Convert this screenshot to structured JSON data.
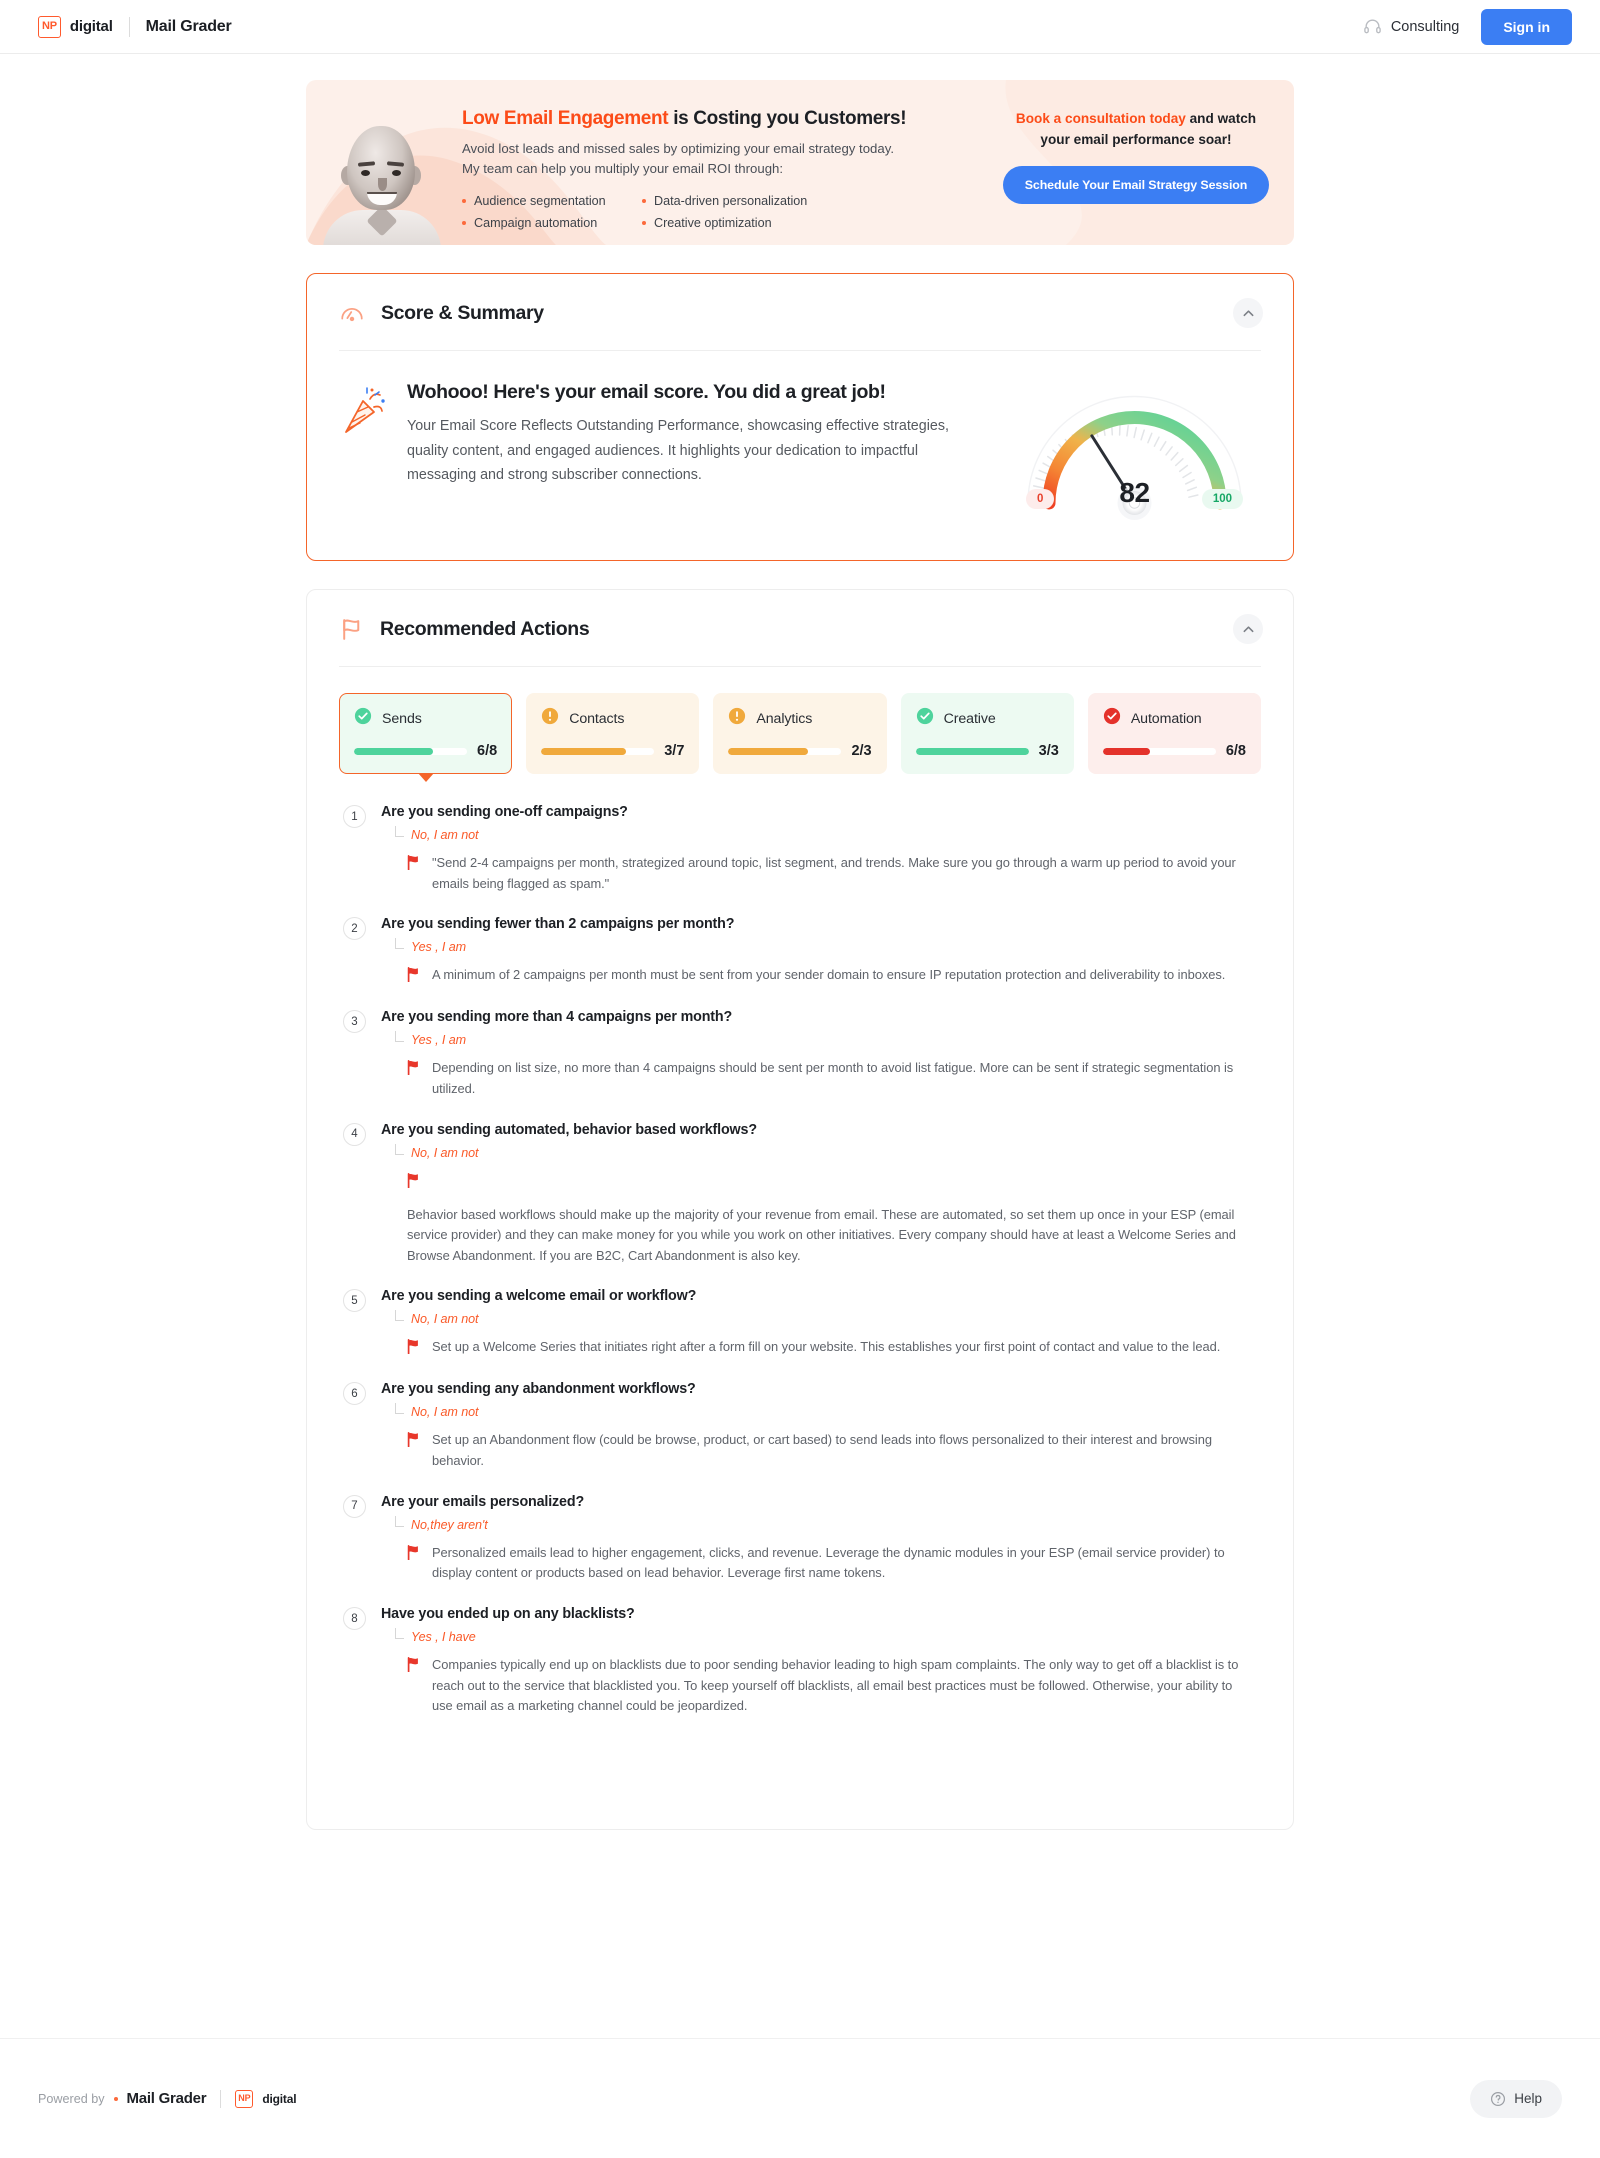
{
  "header": {
    "logo_np": "NP",
    "logo_word": "digital",
    "app_title": "Mail Grader",
    "consulting_label": "Consulting",
    "signin_label": "Sign in"
  },
  "promo": {
    "headline_highlight": "Low Email Engagement",
    "headline_rest": " is Costing you Customers!",
    "sub_line_1": "Avoid lost leads and missed sales by optimizing your email strategy today.",
    "sub_line_2": "My team can help you multiply your email ROI through:",
    "bullets": [
      "Audience segmentation",
      "Data-driven personalization",
      "Campaign automation",
      "Creative optimization"
    ],
    "cta_highlight": "Book a consultation today",
    "cta_rest": " and watch",
    "cta_line2": "your email performance soar!",
    "cta_button": "Schedule Your Email Strategy Session"
  },
  "score_card": {
    "title": "Score & Summary",
    "heading": "Wohooo! Here's your email score. You did a great job!",
    "description": "Your Email Score Reflects Outstanding Performance, showcasing effective strategies, quality content, and engaged audiences. It highlights your dedication to impactful messaging and strong subscriber connections.",
    "gauge": {
      "value": "82",
      "min_label": "0",
      "max_label": "100",
      "min": 0,
      "max": 100,
      "needle_color": "#2b2f36",
      "track_start_color": "#ef4123",
      "track_end_color": "#4ed39c"
    }
  },
  "actions_card": {
    "title": "Recommended Actions",
    "tabs": [
      {
        "label": "Sends",
        "ratio": "6/8",
        "value": 6,
        "total": 8,
        "status": "ok",
        "fill_pct": 70,
        "accent": "#4ed39c",
        "bg": "#edfaf2",
        "active": true
      },
      {
        "label": "Contacts",
        "ratio": "3/7",
        "value": 3,
        "total": 7,
        "status": "warn",
        "fill_pct": 75,
        "accent": "#f0a93c",
        "bg": "#fdf4e7",
        "active": false
      },
      {
        "label": "Analytics",
        "ratio": "2/3",
        "value": 2,
        "total": 3,
        "status": "warn",
        "fill_pct": 70,
        "accent": "#f0a93c",
        "bg": "#fdf4e7",
        "active": false
      },
      {
        "label": "Creative",
        "ratio": "3/3",
        "value": 3,
        "total": 3,
        "status": "ok",
        "fill_pct": 100,
        "accent": "#4ed39c",
        "bg": "#edfaf2",
        "active": false
      },
      {
        "label": "Automation",
        "ratio": "6/8",
        "value": 6,
        "total": 8,
        "status": "error",
        "fill_pct": 42,
        "accent": "#e4322b",
        "bg": "#fdeeec",
        "active": false
      }
    ],
    "questions": [
      {
        "num": "1",
        "question": "Are you sending one-off campaigns?",
        "answer": "No, I am not",
        "advice": "\"Send 2-4 campaigns per month, strategized around topic, list segment, and trends. Make sure you go through a warm up period to avoid your emails being flagged as spam.\"",
        "stacked": false
      },
      {
        "num": "2",
        "question": "Are you sending fewer than 2 campaigns per month?",
        "answer": "Yes , I am",
        "advice": "A minimum of 2 campaigns per month must be sent from your sender domain to ensure IP reputation protection and deliverability to inboxes.",
        "stacked": false
      },
      {
        "num": "3",
        "question": "Are you sending more than 4 campaigns per month?",
        "answer": "Yes , I am",
        "advice": "Depending on list size, no more than 4 campaigns should be sent per month to avoid list fatigue. More can be sent if strategic segmentation is utilized.",
        "stacked": false
      },
      {
        "num": "4",
        "question": "Are you sending automated, behavior based workflows?",
        "answer": "No, I am not",
        "advice": "Behavior based workflows should make up the majority of your revenue from email. These are automated, so set them up once in your ESP (email service provider) and they can make money for you while you work on other initiatives. Every company should have at least a Welcome Series and Browse Abandonment. If you are B2C, Cart Abandonment is also key.",
        "stacked": true
      },
      {
        "num": "5",
        "question": "Are you sending a welcome email or workflow?",
        "answer": "No, I am not",
        "advice": "Set up a Welcome Series that initiates right after a form fill on your website. This establishes your first point of contact and value to the lead.",
        "stacked": false
      },
      {
        "num": "6",
        "question": "Are you sending any abandonment workflows?",
        "answer": "No, I am not",
        "advice": "Set up an Abandonment flow (could be browse, product, or cart based) to send leads into flows personalized to their interest and browsing behavior.",
        "stacked": false
      },
      {
        "num": "7",
        "question": "Are your emails personalized?",
        "answer": "No,they aren't",
        "advice": "Personalized emails lead to higher engagement, clicks, and revenue. Leverage the dynamic modules in your ESP (email service provider) to display content or products based on lead behavior. Leverage first name tokens.",
        "stacked": false
      },
      {
        "num": "8",
        "question": "Have you ended up on any blacklists?",
        "answer": "Yes , I have",
        "advice": "Companies typically end up on blacklists due to poor sending behavior leading to high spam complaints. The only way to get off a blacklist is to reach out to the service that blacklisted you. To keep yourself off blacklists, all email best practices must be followed. Otherwise, your ability to use email as a marketing channel could be jeopardized.",
        "stacked": false
      }
    ]
  },
  "footer": {
    "powered_label": "Powered by",
    "powered_name": "Mail Grader",
    "logo_np": "NP",
    "logo_word": "digital",
    "help_label": "Help"
  }
}
